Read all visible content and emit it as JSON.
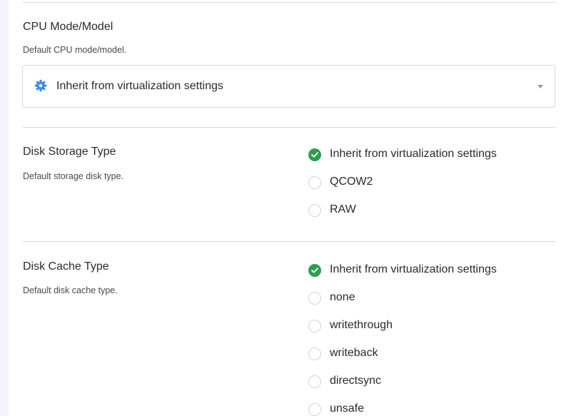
{
  "cpu": {
    "title": "CPU Mode/Model",
    "description": "Default CPU mode/model.",
    "selected": "Inherit from virtualization settings",
    "icon": "gear-icon"
  },
  "disk_storage": {
    "title": "Disk Storage Type",
    "description": "Default storage disk type.",
    "options": [
      {
        "label": "Inherit from virtualization settings",
        "checked": true
      },
      {
        "label": "QCOW2",
        "checked": false
      },
      {
        "label": "RAW",
        "checked": false
      }
    ]
  },
  "disk_cache": {
    "title": "Disk Cache Type",
    "description": "Default disk cache type.",
    "options": [
      {
        "label": "Inherit from virtualization settings",
        "checked": true
      },
      {
        "label": "none",
        "checked": false
      },
      {
        "label": "writethrough",
        "checked": false
      },
      {
        "label": "writeback",
        "checked": false
      },
      {
        "label": "directsync",
        "checked": false
      },
      {
        "label": "unsafe",
        "checked": false
      }
    ]
  },
  "colors": {
    "accent_checked": "#2e9e4f",
    "gear": "#3a8ee6"
  }
}
